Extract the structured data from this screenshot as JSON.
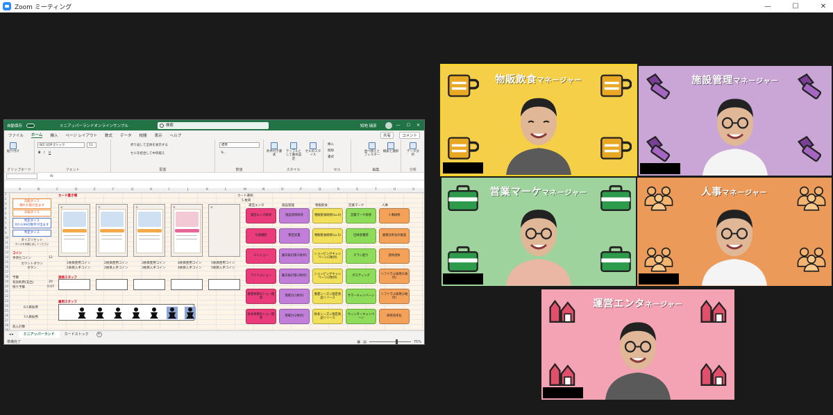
{
  "window": {
    "title": "Zoom ミーティング",
    "controls": [
      "—",
      "☐",
      "✕"
    ]
  },
  "excel": {
    "autosave": "自動保存",
    "filename": "ミニアッパーランドオンラインサンプル",
    "search_placeholder": "検索",
    "user": "知地 瑞彦",
    "window_controls": [
      "—",
      "☐",
      "✕"
    ],
    "menu": [
      "ファイル",
      "ホーム",
      "挿入",
      "ページ レイアウト",
      "数式",
      "データ",
      "校閲",
      "表示",
      "ヘルプ"
    ],
    "active_menu": "ホーム",
    "share": "共有",
    "comment": "コメント",
    "ribbon": {
      "paste": "貼り付け",
      "clipboard": "クリップボード",
      "font_name": "BIZ UDPゴシック",
      "font_size": "11",
      "font": "フォント",
      "wrap": "折り返して全体を表示する",
      "merge": "セルを結合して中央揃え",
      "alignment": "配置",
      "number_format": "標準",
      "number": "数値",
      "cond_format": "条件付き書式",
      "table_format": "テーブルとして書式設定",
      "cell_style": "セルのスタイル",
      "style": "スタイル",
      "insert": "挿入",
      "delete": "削除",
      "format": "書式",
      "cells": "セル",
      "sort_filter": "並べ替えとフィルター",
      "find_select": "検索と選択",
      "editing": "編集",
      "data_analysis": "データ分析",
      "analysis": "分析"
    },
    "columns": [
      "A",
      "B",
      "C",
      "D",
      "E",
      "F",
      "G",
      "H",
      "I",
      "J",
      "K",
      "L",
      "M",
      "N",
      "O",
      "P",
      "Q",
      "R",
      "S",
      "T",
      "U",
      "V",
      "W"
    ],
    "rows": [
      "1",
      "2",
      "3",
      "4",
      "5",
      "6",
      "7",
      "8",
      "9",
      "10",
      "11",
      "12",
      "13",
      "14",
      "15",
      "16",
      "17",
      "18",
      "19",
      "20",
      "21",
      "22",
      "23",
      "24",
      "25",
      "26",
      "27",
      "28",
      "29"
    ],
    "sheet": {
      "card_heading": "カード置き場",
      "dice1_line1": "汎能ダイス",
      "dice1_line2": "晴れか雨が出ます",
      "dice2_label": "天候ダイス",
      "dice3_line1": "判定ダイス",
      "dice3_line2": "0から99の数字が出ます",
      "dice4_label": "判定ダイス",
      "dice_reset_line1": "ダイスリセット",
      "dice_reset_line2": "ダイスを初期に戻してください",
      "coin_label": "コイン",
      "coin_row1": "手持ちコイン",
      "coin_row1_value": "12",
      "countdown_line1": "カウントダウン",
      "countdown_line2": "ボタン",
      "budget_label": "予算",
      "budget_row1": "有効利用(支出)",
      "budget_row1_value": "20",
      "budget_row2": "残り予算",
      "budget_row2_value": "0.07",
      "hire_label": "雇用スタッフ",
      "hire_six": "6人目採用",
      "hire_seven": "7人目採用",
      "practice_label": "実践スタッフ",
      "income_label": "収入計算",
      "card_indices": [
        "①",
        "②",
        "③",
        "④",
        "⑤"
      ],
      "card_slot_coins": [
        [
          "1枚目使用コイン",
          "1枚目入手コイン"
        ],
        [
          "2枚目使用コイン",
          "2枚目入手コイン"
        ],
        [
          "3枚目使用コイン",
          "3枚目入手コイン"
        ],
        [
          "4枚目使用コイン",
          "4枚目入手コイン"
        ],
        [
          "5枚目使用コイン",
          "5枚目入手コイン"
        ]
      ],
      "card_select": "カード選択",
      "card_count": "5 枚目",
      "categories": [
        "運営エンタ",
        "施設管理",
        "物販飲食",
        "営業マーケ",
        "人事"
      ],
      "kamoku_grid": [
        [
          "運営エンタ研修",
          "施設管理研修",
          "物販飲食研修(Lv.4)",
          "営業マーケ研修",
          "人事研修"
        ],
        [
          "写真撮影",
          "整定処置",
          "物販飲食研修(Lv.5)",
          "団体客獲得",
          "業務効率化の推進"
        ],
        [
          "ミニショー",
          "園天候対策(1枚目)",
          "ショッピングキャンペーン(1枚目)",
          "チラシ配り",
          "週休週休"
        ],
        [
          "アイドルショー",
          "園天候対策(2枚目)",
          "ショッピングキャンペーン(2枚目)",
          "ポスティング",
          "リファラル採用(1枚目)"
        ],
        [
          "春夏季節のショー開発",
          "現場力(1枚目)",
          "春夏シーズン限定商品リリース",
          "サマーキャンペーン",
          "リファラル採用(2枚目)"
        ],
        [
          "秋冬季節のショー開発",
          "現場力(2枚目)",
          "秋冬シーズン限定商品リリース",
          "ウィンターキャンペーン",
          "研修効率化"
        ]
      ]
    },
    "tabs": [
      "ミニアッパーランド",
      "カードストック"
    ],
    "active_tab": "ミニアッパーランド",
    "status": "準備完了",
    "zoom": "75%"
  },
  "tiles": [
    {
      "id": "buppan",
      "label_main": "物販飲食",
      "label_sub": "マネージャー",
      "bg": "#f4cf47"
    },
    {
      "id": "shisetsu",
      "label_main": "施設管理",
      "label_sub": "マネージャー",
      "bg": "#c9a6d6"
    },
    {
      "id": "eigyo",
      "label_main": "営業マーケ",
      "label_sub": "マネージャー",
      "bg": "#9fd39d"
    },
    {
      "id": "jinji",
      "label_main": "人事",
      "label_sub": "マネージャー",
      "bg": "#ec9a5a"
    },
    {
      "id": "unei",
      "label_main": "運営エンタ",
      "label_sub": "ネージャー",
      "bg": "#f4a3b5"
    }
  ],
  "icons": {
    "mug": "mug-icon",
    "bolt": "bolt-icon",
    "briefcase": "briefcase-icon",
    "people": "people-icon",
    "castle": "castle-icon"
  }
}
